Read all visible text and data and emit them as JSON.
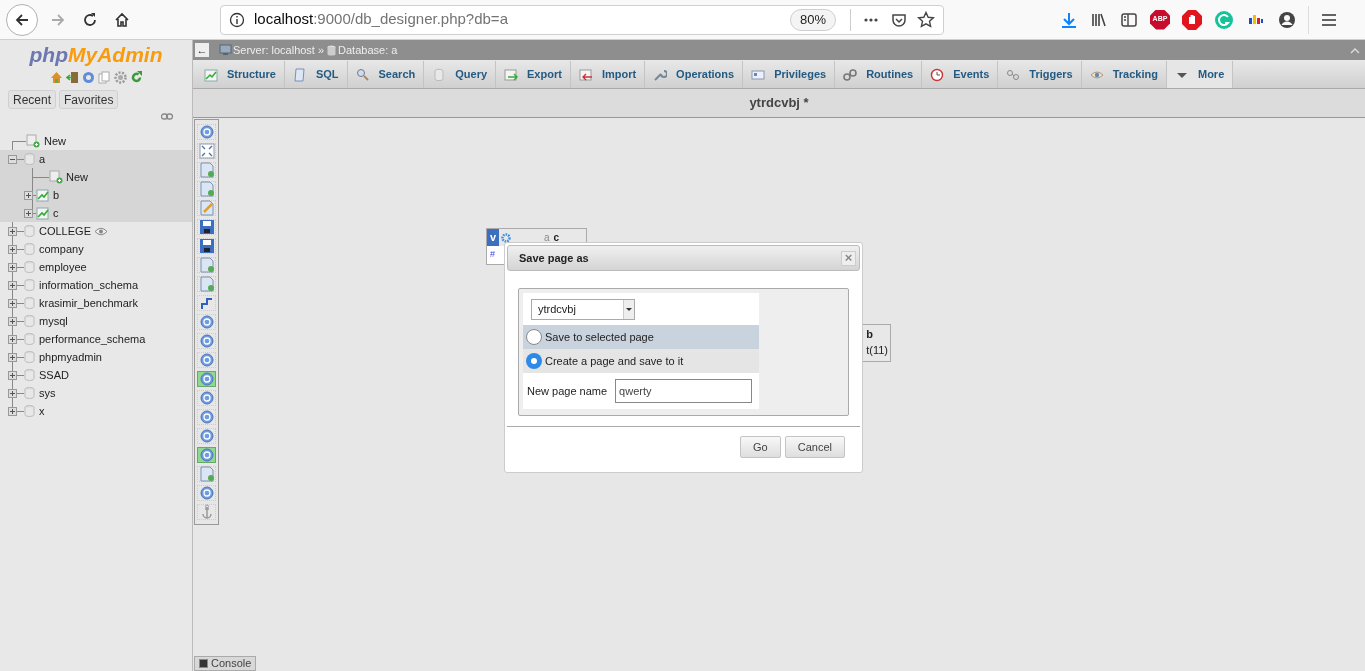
{
  "browser": {
    "url": {
      "host": "localhost",
      "path": ":9000/db_designer.php?db=a"
    },
    "zoom": "80%",
    "forward_disabled": true,
    "adblock_label": "ABP"
  },
  "navigation": {
    "logo": {
      "first": "php",
      "second": "MyAdmin"
    },
    "buttons": [
      "Recent",
      "Favorites"
    ],
    "tree": [
      {
        "label": "New",
        "kind": "new",
        "selected": false,
        "tracked": false
      },
      {
        "label": "a",
        "kind": "database",
        "selected": true,
        "tracked": false,
        "expanded": true,
        "children": [
          {
            "label": "New",
            "kind": "new"
          },
          {
            "label": "b",
            "kind": "table"
          },
          {
            "label": "c",
            "kind": "table"
          }
        ]
      },
      {
        "label": "COLLEGE",
        "kind": "database",
        "selected": false,
        "tracked": true,
        "expanded": false
      },
      {
        "label": "company",
        "kind": "database",
        "selected": false,
        "tracked": false,
        "expanded": false
      },
      {
        "label": "employee",
        "kind": "database",
        "selected": false,
        "tracked": false,
        "expanded": false
      },
      {
        "label": "information_schema",
        "kind": "database",
        "selected": false,
        "tracked": false,
        "expanded": false
      },
      {
        "label": "krasimir_benchmark",
        "kind": "database",
        "selected": false,
        "tracked": false,
        "expanded": false
      },
      {
        "label": "mysql",
        "kind": "database",
        "selected": false,
        "tracked": false,
        "expanded": false
      },
      {
        "label": "performance_schema",
        "kind": "database",
        "selected": false,
        "tracked": false,
        "expanded": false
      },
      {
        "label": "phpmyadmin",
        "kind": "database",
        "selected": false,
        "tracked": false,
        "expanded": false
      },
      {
        "label": "SSAD",
        "kind": "database",
        "selected": false,
        "tracked": false,
        "expanded": false
      },
      {
        "label": "sys",
        "kind": "database",
        "selected": false,
        "tracked": false,
        "expanded": false
      },
      {
        "label": "x",
        "kind": "database",
        "selected": false,
        "tracked": false,
        "expanded": false
      }
    ]
  },
  "breadcrumb": {
    "collapse": "←",
    "server": "Server: localhost",
    "separator": "»",
    "database": "Database: a"
  },
  "tabs": [
    {
      "label": "Structure",
      "selected": false
    },
    {
      "label": "SQL",
      "selected": false
    },
    {
      "label": "Search",
      "selected": false
    },
    {
      "label": "Query",
      "selected": false
    },
    {
      "label": "Export",
      "selected": false
    },
    {
      "label": "Import",
      "selected": false
    },
    {
      "label": "Operations",
      "selected": false
    },
    {
      "label": "Privileges",
      "selected": false
    },
    {
      "label": "Routines",
      "selected": false
    },
    {
      "label": "Events",
      "selected": false
    },
    {
      "label": "Triggers",
      "selected": false
    },
    {
      "label": "Tracking",
      "selected": false
    },
    {
      "label": "More",
      "selected": true
    }
  ],
  "page_title": "ytrdcvbj *",
  "designer_tools": [
    {
      "kind": "circle",
      "active": false
    },
    {
      "kind": "expand",
      "active": false
    },
    {
      "kind": "page",
      "active": false
    },
    {
      "kind": "page",
      "active": false
    },
    {
      "kind": "edit",
      "active": false
    },
    {
      "kind": "save",
      "active": false
    },
    {
      "kind": "save",
      "active": false
    },
    {
      "kind": "page",
      "active": false
    },
    {
      "kind": "page",
      "active": false
    },
    {
      "kind": "line",
      "active": false
    },
    {
      "kind": "circle",
      "active": false
    },
    {
      "kind": "circle",
      "active": false
    },
    {
      "kind": "circle",
      "active": false
    },
    {
      "kind": "circle",
      "active": true
    },
    {
      "kind": "circle",
      "active": false
    },
    {
      "kind": "circle",
      "active": false
    },
    {
      "kind": "circle",
      "active": false
    },
    {
      "kind": "circle",
      "active": true
    },
    {
      "kind": "page",
      "active": false
    },
    {
      "kind": "circle",
      "active": false
    },
    {
      "kind": "anchor",
      "active": false
    }
  ],
  "tables": [
    {
      "toggle": "v",
      "database": "a",
      "name": "c",
      "column": "#"
    },
    {
      "name": "b",
      "column": "t(11)"
    }
  ],
  "dialog": {
    "title": "Save page as",
    "close": "×",
    "page_select": "ytrdcvbj",
    "options": [
      {
        "label": "Save to selected page",
        "selected": false
      },
      {
        "label": "Create a page and save to it",
        "selected": true
      }
    ],
    "name_label": "New page name",
    "name_value": "qwerty",
    "buttons": [
      "Go",
      "Cancel"
    ]
  },
  "console": "Console"
}
